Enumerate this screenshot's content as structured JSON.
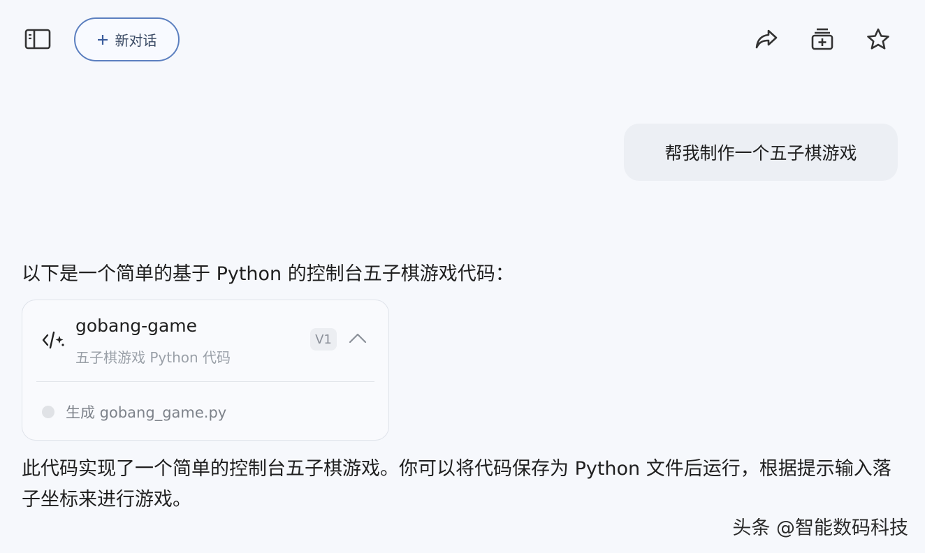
{
  "header": {
    "new_chat_label": "新对话",
    "icons": [
      "sidebar-icon",
      "plus-icon",
      "share-icon",
      "add-to-collection-icon",
      "star-icon"
    ]
  },
  "user_message": {
    "text": "帮我制作一个五子棋游戏"
  },
  "assistant": {
    "intro": "以下是一个简单的基于 Python 的控制台五子棋游戏代码：",
    "code_card": {
      "title": "gobang-game",
      "subtitle": "五子棋游戏 Python 代码",
      "version": "V1",
      "status_text": "生成 gobang_game.py",
      "icon": "code-icon"
    },
    "closing": "此代码实现了一个简单的控制台五子棋游戏。你可以将代码保存为 Python 文件后运行，根据提示输入落子坐标来进行游戏。"
  },
  "watermark": "头条 @智能数码科技",
  "colors": {
    "background": "#f6f8fc",
    "bubble": "#eceff4",
    "button_border": "#5b7fbf"
  }
}
